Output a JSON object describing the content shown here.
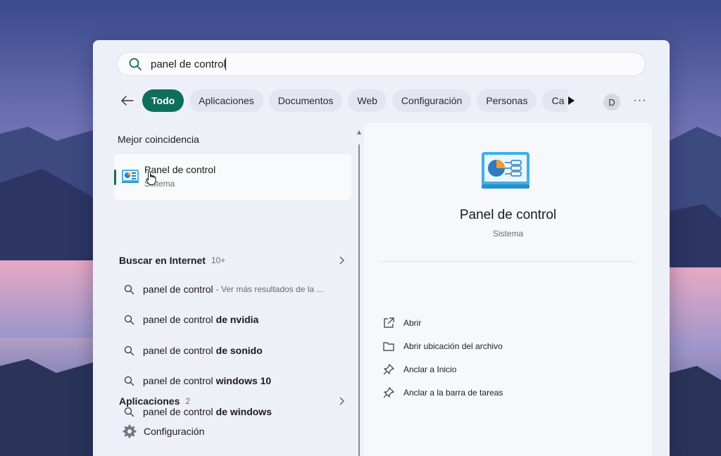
{
  "search": {
    "query": "panel de control"
  },
  "tabs": [
    {
      "label": "Todo",
      "active": true
    },
    {
      "label": "Aplicaciones"
    },
    {
      "label": "Documentos"
    },
    {
      "label": "Web"
    },
    {
      "label": "Configuración"
    },
    {
      "label": "Personas"
    },
    {
      "label": "Ca"
    }
  ],
  "account": {
    "initial": "D"
  },
  "more_label": "···",
  "best_match": {
    "title": "Mejor coincidencia",
    "name": "Panel de control",
    "type": "Sistema"
  },
  "internet": {
    "label": "Buscar en Internet",
    "count": "10+",
    "items": [
      {
        "prefix": "panel de control",
        "suffix": "- Ver más resultados de la ..."
      },
      {
        "prefix": "panel de control",
        "bold": "de nvidia"
      },
      {
        "prefix": "panel de control",
        "bold": "de sonido"
      },
      {
        "prefix": "panel de control",
        "bold": "windows 10"
      },
      {
        "prefix": "panel de control",
        "bold": "de windows"
      }
    ]
  },
  "apps": {
    "label": "Aplicaciones",
    "count": "2",
    "items": [
      {
        "name": "Configuración",
        "icon": "gear-icon"
      }
    ]
  },
  "detail": {
    "name": "Panel de control",
    "type": "Sistema",
    "actions": [
      {
        "label": "Abrir",
        "icon": "open-external-icon"
      },
      {
        "label": "Abrir ubicación del archivo",
        "icon": "folder-icon"
      },
      {
        "label": "Anclar a Inicio",
        "icon": "pin-icon"
      },
      {
        "label": "Anclar a la barra de tareas",
        "icon": "pin-icon"
      }
    ]
  },
  "colors": {
    "accent": "#0f6e58",
    "panel": "#eef0f8"
  }
}
